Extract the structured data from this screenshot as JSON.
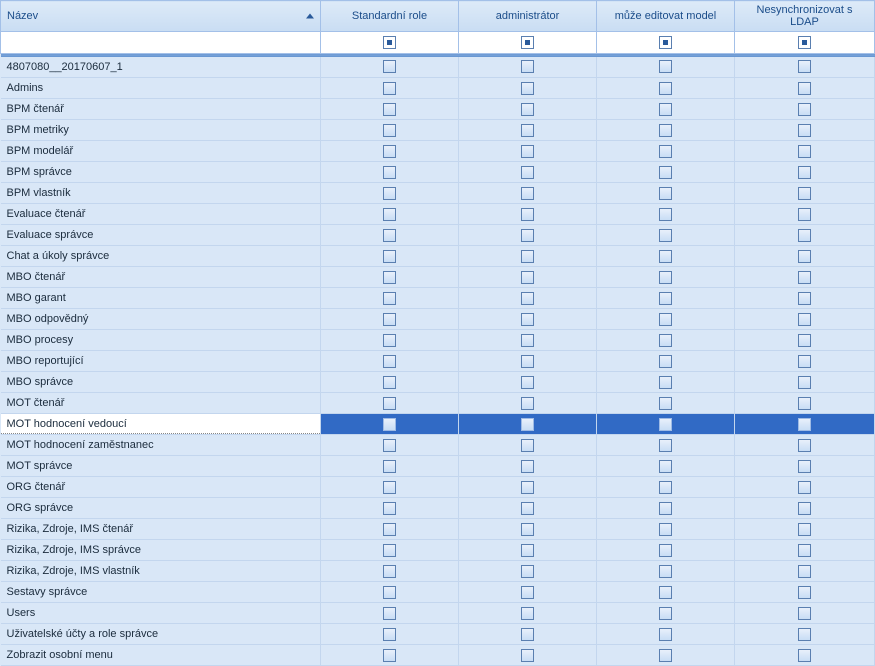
{
  "columns": {
    "name": {
      "label": "Název"
    },
    "std": {
      "label": "Standardní role"
    },
    "admin": {
      "label": "administrátor"
    },
    "edit": {
      "label": "může editovat model"
    },
    "ldap": {
      "label": "Nesynchronizovat s LDAP"
    }
  },
  "selected_row": "MOT hodnocení vedoucí",
  "rows": [
    {
      "name": "4807080__20170607_1"
    },
    {
      "name": "Admins"
    },
    {
      "name": "BPM čtenář"
    },
    {
      "name": "BPM metriky"
    },
    {
      "name": "BPM modelář"
    },
    {
      "name": "BPM správce"
    },
    {
      "name": "BPM vlastník"
    },
    {
      "name": "Evaluace čtenář"
    },
    {
      "name": "Evaluace správce"
    },
    {
      "name": "Chat a úkoly správce"
    },
    {
      "name": "MBO čtenář"
    },
    {
      "name": "MBO garant"
    },
    {
      "name": "MBO odpovědný"
    },
    {
      "name": "MBO procesy"
    },
    {
      "name": "MBO reportující"
    },
    {
      "name": "MBO správce"
    },
    {
      "name": "MOT čtenář"
    },
    {
      "name": "MOT hodnocení vedoucí"
    },
    {
      "name": "MOT hodnocení zaměstnanec"
    },
    {
      "name": "MOT správce"
    },
    {
      "name": "ORG čtenář"
    },
    {
      "name": "ORG správce"
    },
    {
      "name": "Rizika, Zdroje, IMS čtenář"
    },
    {
      "name": "Rizika, Zdroje, IMS správce"
    },
    {
      "name": "Rizika, Zdroje, IMS vlastník"
    },
    {
      "name": "Sestavy správce"
    },
    {
      "name": "Users"
    },
    {
      "name": "Uživatelské účty a role správce"
    },
    {
      "name": "Zobrazit osobní menu"
    }
  ]
}
